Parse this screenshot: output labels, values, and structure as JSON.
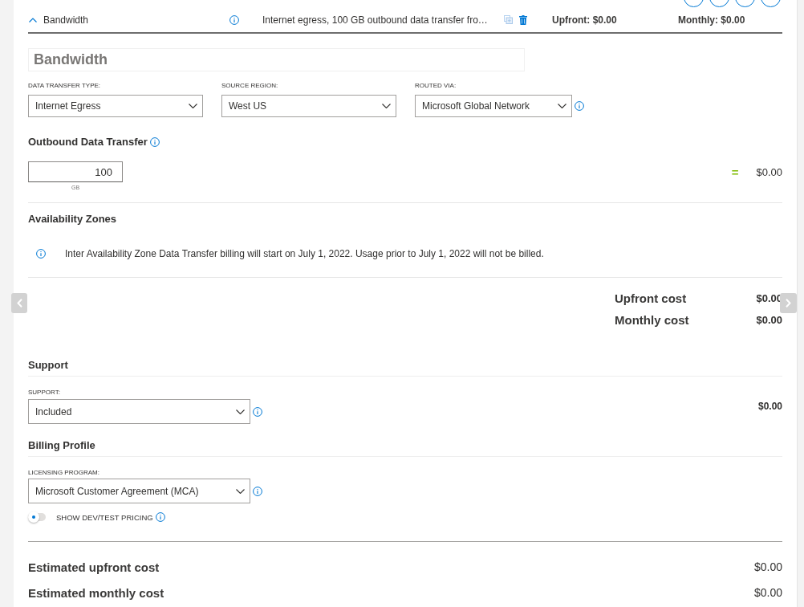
{
  "service_header": {
    "expanded": true,
    "name": "Bandwidth",
    "description": "Internet egress, 100 GB outbound data transfer fro…",
    "upfront": "Upfront: $0.00",
    "monthly": "Monthly: $0.00"
  },
  "name_field": {
    "value": "Bandwidth"
  },
  "selectors": [
    {
      "label": "DATA TRANSFER TYPE:",
      "value": "Internet Egress",
      "info": false
    },
    {
      "label": "SOURCE REGION:",
      "value": "West US",
      "info": false
    },
    {
      "label": "ROUTED VIA:",
      "value": "Microsoft Global Network",
      "info": true
    }
  ],
  "outbound": {
    "title": "Outbound Data Transfer",
    "value": "100",
    "unit": "GB",
    "equals": "=",
    "cost": "$0.00"
  },
  "availability_zones": {
    "title": "Availability Zones",
    "notice": "Inter Availability Zone Data Transfer billing will start on July 1, 2022. Usage prior to July 1, 2022 will not be billed."
  },
  "totals": [
    {
      "label": "Upfront cost",
      "value": "$0.00"
    },
    {
      "label": "Monthly cost",
      "value": "$0.00"
    }
  ],
  "support": {
    "title": "Support",
    "label": "SUPPORT:",
    "value": "Included",
    "cost": "$0.00"
  },
  "billing_profile": {
    "title": "Billing Profile",
    "label": "LICENSING PROGRAM:",
    "value": "Microsoft Customer Agreement (MCA)",
    "dev_test_toggle": {
      "label": "SHOW DEV/TEST PRICING",
      "on": false
    }
  },
  "estimates": [
    {
      "label": "Estimated upfront cost",
      "value": "$0.00"
    },
    {
      "label": "Estimated monthly cost",
      "value": "$0.00"
    }
  ]
}
